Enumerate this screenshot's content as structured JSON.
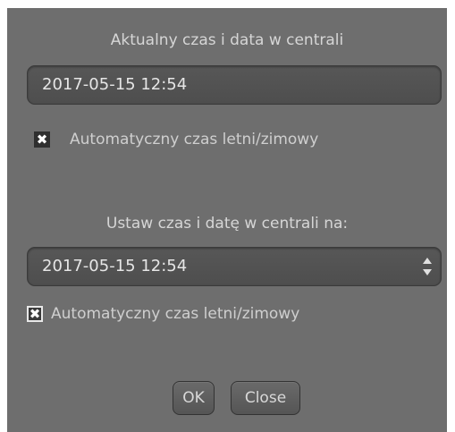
{
  "current": {
    "heading": "Aktualny czas i data w centrali",
    "datetime": "2017-05-15 12:54",
    "dst_checked": true,
    "dst_label": "Automatyczny czas letni/zimowy"
  },
  "set": {
    "heading": "Ustaw czas i datę w centrali na:",
    "datetime": "2017-05-15 12:54",
    "dst_checked": true,
    "dst_label": "Automatyczny czas letni/zimowy"
  },
  "buttons": {
    "ok": "OK",
    "close": "Close"
  },
  "icons": {
    "checkbox_mark": "✖",
    "spin_up": "up-arrow-icon",
    "spin_down": "down-arrow-icon"
  },
  "colors": {
    "panel": "#6e6e6e",
    "text": "#d6d6d6"
  }
}
